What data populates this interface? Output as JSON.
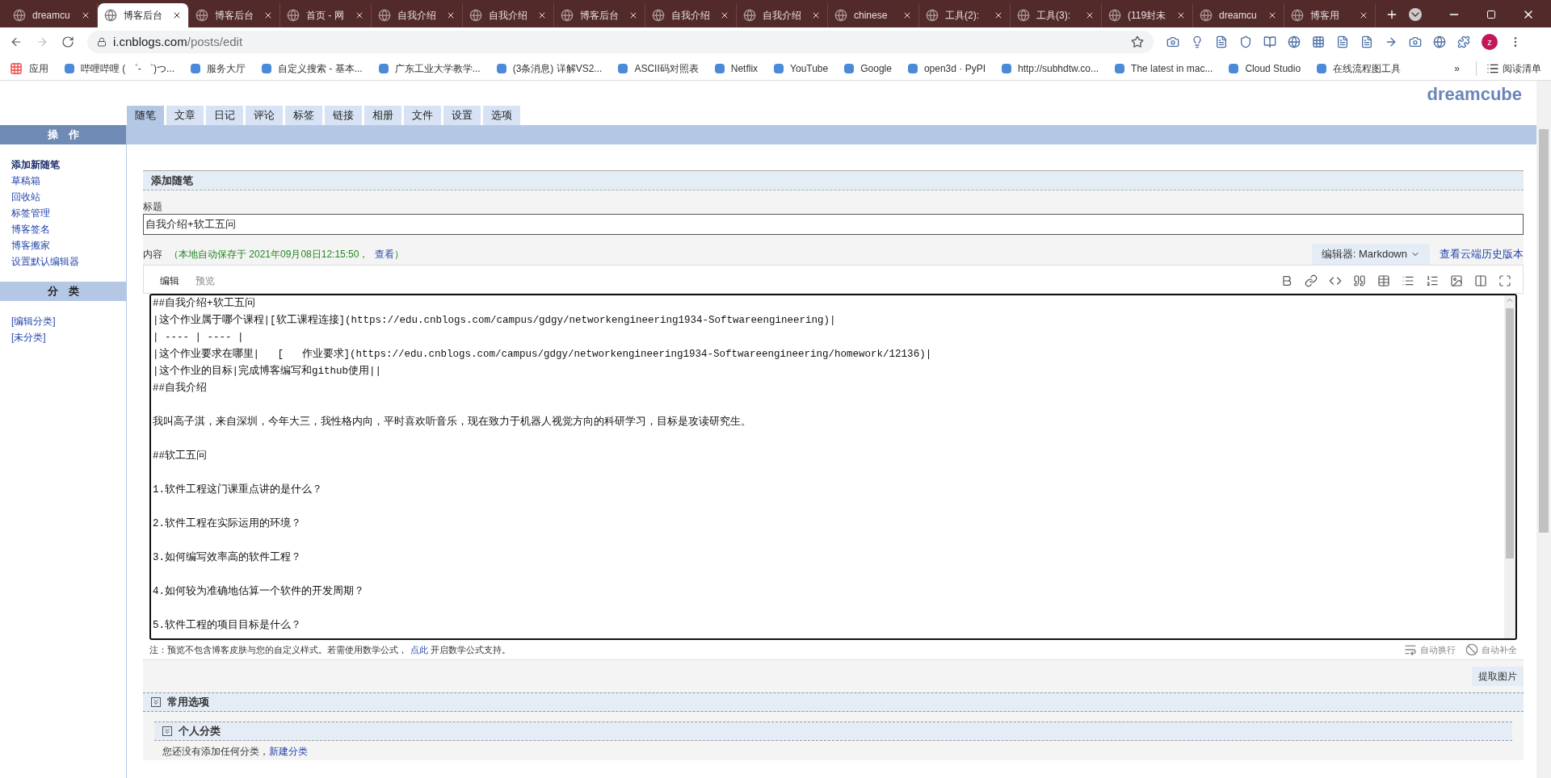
{
  "browser": {
    "tabs": [
      {
        "title": "dreamcu",
        "selected": false
      },
      {
        "title": "博客后台",
        "selected": true
      },
      {
        "title": "博客后台",
        "selected": false
      },
      {
        "title": "首页 - 网",
        "selected": false
      },
      {
        "title": "自我介绍",
        "selected": false
      },
      {
        "title": "自我介绍",
        "selected": false
      },
      {
        "title": "博客后台",
        "selected": false
      },
      {
        "title": "自我介绍",
        "selected": false
      },
      {
        "title": "自我介绍",
        "selected": false
      },
      {
        "title": "chinese",
        "selected": false
      },
      {
        "title": "工具(2):",
        "selected": false
      },
      {
        "title": "工具(3):",
        "selected": false
      },
      {
        "title": "(119封未",
        "selected": false
      },
      {
        "title": "dreamcu",
        "selected": false
      },
      {
        "title": "博客用",
        "selected": false
      }
    ],
    "url_host": "i.cnblogs.com",
    "url_path": "/posts/edit",
    "profile": "z",
    "apps": "应用",
    "bookmarks": [
      "哔哩哔哩 ( ゜- ゜)つ...",
      "服务大厅",
      "自定义搜索 - 基本...",
      "广东工业大学教学...",
      "(3条消息) 详解VS2...",
      "ASCII码对照表",
      "Netflix",
      "YouTube",
      "Google",
      "open3d · PyPI",
      "http://subhdtw.co...",
      "The latest in mac...",
      "Cloud Studio",
      "在线流程图工具"
    ],
    "more": "»",
    "reading_list": "阅读清单"
  },
  "site": {
    "brand": "dreamcube",
    "nav_tabs": [
      {
        "label": "随笔",
        "selected": true
      },
      {
        "label": "文章",
        "selected": false
      },
      {
        "label": "日记",
        "selected": false
      },
      {
        "label": "评论",
        "selected": false
      },
      {
        "label": "标签",
        "selected": false
      },
      {
        "label": "链接",
        "selected": false
      },
      {
        "label": "相册",
        "selected": false
      },
      {
        "label": "文件",
        "selected": false
      },
      {
        "label": "设置",
        "selected": false
      },
      {
        "label": "选项",
        "selected": false
      }
    ],
    "sidebar": [
      {
        "title": "操　作",
        "items": [
          {
            "label": "添加新随笔",
            "selected": true
          },
          {
            "label": "草稿箱",
            "selected": false
          },
          {
            "label": "回收站",
            "selected": false
          },
          {
            "label": "标签管理",
            "selected": false
          },
          {
            "label": "博客签名",
            "selected": false
          },
          {
            "label": "博客搬家",
            "selected": false
          },
          {
            "label": "设置默认编辑器",
            "selected": false
          }
        ]
      },
      {
        "title": "分　类",
        "items": [
          {
            "label": "[编辑分类]",
            "selected": false
          },
          {
            "label": "[未分类]",
            "selected": false
          }
        ]
      }
    ]
  },
  "editor": {
    "section_title": "添加随笔",
    "title_label": "标题",
    "title_value": "自我介绍+软工五问",
    "content_label": "内容",
    "autosave": "（本地自动保存于 2021年09月08日12:15:50，",
    "autosave_link": "查看",
    "autosave_end": "）",
    "editor_select": "编辑器: Markdown",
    "history_link": "查看云端历史版本",
    "mode_tabs": [
      {
        "label": "编辑",
        "selected": true
      },
      {
        "label": "预览",
        "selected": false
      }
    ],
    "lines": [
      {
        "kind": "text",
        "text": "##自我介绍+软工五问"
      },
      {
        "kind": "text",
        "text": "|这个作业属于哪个课程|[软工课程连接](https://edu.cnblogs.com/campus/gdgy/networkengineering1934-Softwareengineering)|"
      },
      {
        "kind": "text",
        "text": "| ---- | ---- |"
      },
      {
        "kind": "text",
        "text": "|这个作业要求在哪里|   [   作业要求](https://edu.cnblogs.com/campus/gdgy/networkengineering1934-Softwareengineering/homework/12136)|"
      },
      {
        "kind": "text",
        "text": "|这个作业的目标|完成博客编写和github使用||"
      },
      {
        "kind": "text",
        "text": "##自我介绍"
      },
      {
        "kind": "blank"
      },
      {
        "kind": "text",
        "text": "我叫高子淇，来自深圳，今年大三，我性格内向，平时喜欢听音乐，现在致力于机器人视觉方向的科研学习，目标是攻读研究生。"
      },
      {
        "kind": "blank"
      },
      {
        "kind": "text",
        "text": "##软工五问"
      },
      {
        "kind": "blank"
      },
      {
        "kind": "text",
        "text": "1.软件工程这门课重点讲的是什么？"
      },
      {
        "kind": "blank"
      },
      {
        "kind": "text",
        "text": "2.软件工程在实际运用的环境？"
      },
      {
        "kind": "blank"
      },
      {
        "kind": "text",
        "text": "3.如何编写效率高的软件工程？"
      },
      {
        "kind": "blank"
      },
      {
        "kind": "text",
        "text": "4.如何较为准确地估算一个软件的开发周期？"
      },
      {
        "kind": "blank"
      },
      {
        "kind": "text",
        "text": "5.软件工程的项目目标是什么？"
      }
    ],
    "note": "注：预览不包含博客皮肤与您的自定义样式。若需使用数学公式，",
    "note_link": "点此",
    "note_end": " 开启数学公式支持。",
    "wrap_label": "自动换行",
    "complete_label": "自动补全",
    "extract_button": "提取图片",
    "options_title": "常用选项",
    "category_title": "个人分类",
    "category_empty": "您还没有添加任何分类，",
    "category_link": "新建分类"
  }
}
